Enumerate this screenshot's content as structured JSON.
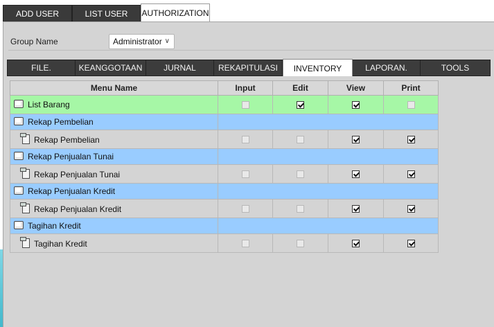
{
  "top_tabs": [
    "ADD USER",
    "LIST USER",
    "AUTHORIZATION"
  ],
  "active_top_tab": "AUTHORIZATION",
  "group": {
    "label": "Group Name",
    "selected": "Administrator"
  },
  "module_tabs": [
    "FILE.",
    "KEANGGOTAAN",
    "JURNAL",
    "REKAPITULASI",
    "INVENTORY",
    "LAPORAN.",
    "TOOLS"
  ],
  "active_module_tab": "INVENTORY",
  "table": {
    "columns": [
      "Menu Name",
      "Input",
      "Edit",
      "View",
      "Print"
    ],
    "rows": [
      {
        "name": "List Barang",
        "kind": "root",
        "input": "disabled",
        "edit": "checked",
        "view": "checked",
        "print": "disabled"
      },
      {
        "name": "Rekap Pembelian",
        "kind": "group"
      },
      {
        "name": "Rekap Pembelian",
        "kind": "item",
        "input": "disabled",
        "edit": "disabled",
        "view": "checked",
        "print": "checked"
      },
      {
        "name": "Rekap Penjualan Tunai",
        "kind": "group"
      },
      {
        "name": "Rekap Penjualan Tunai",
        "kind": "item",
        "input": "disabled",
        "edit": "disabled",
        "view": "checked",
        "print": "checked"
      },
      {
        "name": "Rekap Penjualan Kredit",
        "kind": "group"
      },
      {
        "name": "Rekap Penjualan Kredit",
        "kind": "item",
        "input": "disabled",
        "edit": "disabled",
        "view": "checked",
        "print": "checked"
      },
      {
        "name": "Tagihan Kredit",
        "kind": "group"
      },
      {
        "name": "Tagihan Kredit",
        "kind": "item",
        "input": "disabled",
        "edit": "disabled",
        "view": "checked",
        "print": "checked"
      }
    ]
  },
  "colors": {
    "root_row": "#a6f7a6",
    "group_row": "#99ccff",
    "item_row": "#d4d4d4",
    "tab_bar": "#3c3c3c"
  }
}
